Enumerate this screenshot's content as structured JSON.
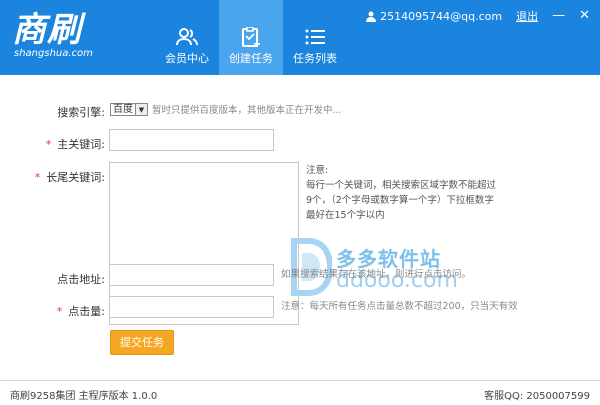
{
  "logo": {
    "main": "商刷",
    "sub": "shangshua.com"
  },
  "nav": [
    {
      "label": "会员中心",
      "icon": "users-icon"
    },
    {
      "label": "创建任务",
      "icon": "clipboard-add-icon"
    },
    {
      "label": "任务列表",
      "icon": "list-icon"
    }
  ],
  "user": {
    "email": "2514095744@qq.com",
    "logout": "退出",
    "minimize": "—",
    "close": "✕"
  },
  "form": {
    "engine_label": "搜索引擎:",
    "engine_value": "百度",
    "engine_hint": "暂时只提供百度版本，其他版本正在开发中...",
    "required_mark": "*",
    "main_kw_label": "主关键词:",
    "longtail_label": "长尾关键词:",
    "longtail_hint": [
      "注意:",
      "每行一个关键词，相关搜索区域字数不能超过",
      "9个，（2个字母或数字算一个字）下拉框数字",
      "最好在15个字以内"
    ],
    "url_label": "点击地址:",
    "url_hint": "如果搜索结果存在该地址，则进行点击访问。",
    "clicks_label": "点击量:",
    "clicks_hint": "注意：每天所有任务点击量总数不超过200，只当天有效",
    "submit": "提交任务"
  },
  "watermark": {
    "cn": "多多软件站",
    "url": "ddooo.com"
  },
  "footer": {
    "left": "商刷9258集团 主程序版本 1.0.0",
    "right": "客服QQ: 2050007599"
  },
  "colors": {
    "header": "#1a84de",
    "active_tab": "#4ba4ee",
    "submit": "#f5a623",
    "required": "#e33333"
  }
}
